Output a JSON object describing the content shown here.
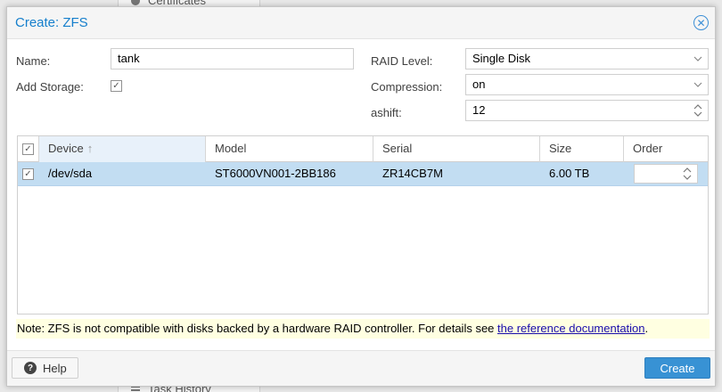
{
  "background": {
    "top_item": "Certificates",
    "bottom_item": "Task History"
  },
  "dialog": {
    "title": "Create: ZFS"
  },
  "form": {
    "name_label": "Name:",
    "name_value": "tank",
    "add_storage_label": "Add Storage:",
    "add_storage_checked": true,
    "raid_level_label": "RAID Level:",
    "raid_level_value": "Single Disk",
    "compression_label": "Compression:",
    "compression_value": "on",
    "ashift_label": "ashift:",
    "ashift_value": "12"
  },
  "grid": {
    "columns": [
      "Device",
      "Model",
      "Serial",
      "Size",
      "Order"
    ],
    "sorted_column": "Device",
    "rows": [
      {
        "selected": true,
        "device": "/dev/sda",
        "model": "ST6000VN001-2BB186",
        "serial": "ZR14CB7M",
        "size": "6.00 TB",
        "order": ""
      }
    ]
  },
  "note": {
    "text": "Note: ZFS is not compatible with disks backed by a hardware RAID controller. For details see ",
    "link_text": "the reference documentation",
    "suffix": "."
  },
  "footer": {
    "help_label": "Help",
    "create_label": "Create"
  },
  "colors": {
    "accent": "#157fcc",
    "selected_row": "#c2ddf2",
    "note_bg": "#ffffe1",
    "primary_button": "#3892d4"
  }
}
